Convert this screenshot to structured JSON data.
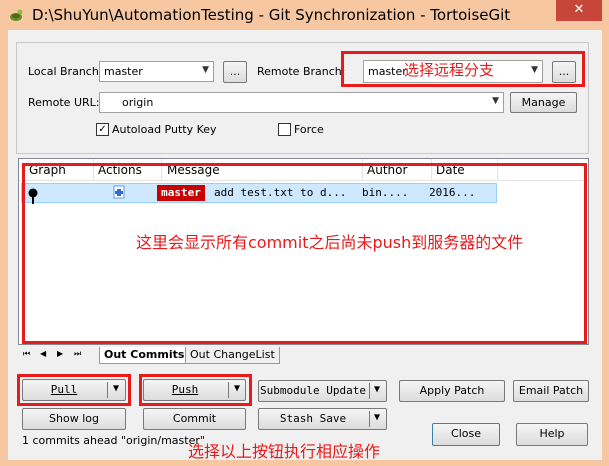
{
  "window": {
    "title": "D:\\ShuYun\\AutomationTesting - Git Synchronization - TortoiseGit",
    "close_glyph": "✕",
    "icon": "tortoisegit-icon"
  },
  "branches": {
    "local_label": "Local Branch:",
    "local_value": "master",
    "remote_label": "Remote Branch:",
    "remote_value": "master",
    "browse_label": "...",
    "annotation_remote": "选择远程分支"
  },
  "remote": {
    "label": "Remote URL:",
    "value": "origin",
    "manage_label": "Manage"
  },
  "options": {
    "autoload_label": "Autoload Putty Key",
    "autoload_checked": true,
    "force_label": "Force",
    "force_checked": false
  },
  "commit_list": {
    "columns": [
      "Graph",
      "Actions",
      "Message",
      "Author",
      "Date"
    ],
    "rows": [
      {
        "branch": "master",
        "message": "add test.txt to d...",
        "author": "bin....",
        "date": "2016..."
      }
    ],
    "annotation": "这里会显示所有commit之后尚未push到服务器的文件"
  },
  "tabs": {
    "nav": [
      "⏮",
      "◀",
      "▶",
      "⏭"
    ],
    "items": [
      "Out Commits",
      "Out ChangeList"
    ]
  },
  "actions": {
    "pull_label": "Pull",
    "push_label": "Push",
    "submodule_label": "Submodule Update",
    "apply_patch_label": "Apply Patch",
    "email_patch_label": "Email Patch",
    "show_log_label": "Show log",
    "commit_label": "Commit",
    "stash_label": "Stash Save",
    "close_label": "Close",
    "help_label": "Help",
    "annotation": "选择以上按钮执行相应操作"
  },
  "status": {
    "text": "1 commits ahead \"origin/master\""
  },
  "colors": {
    "title_bar": "#f7c7a2",
    "annotation_red": "#e81b1b",
    "selection": "#cde8ff",
    "branch_tag": "#c80000"
  }
}
